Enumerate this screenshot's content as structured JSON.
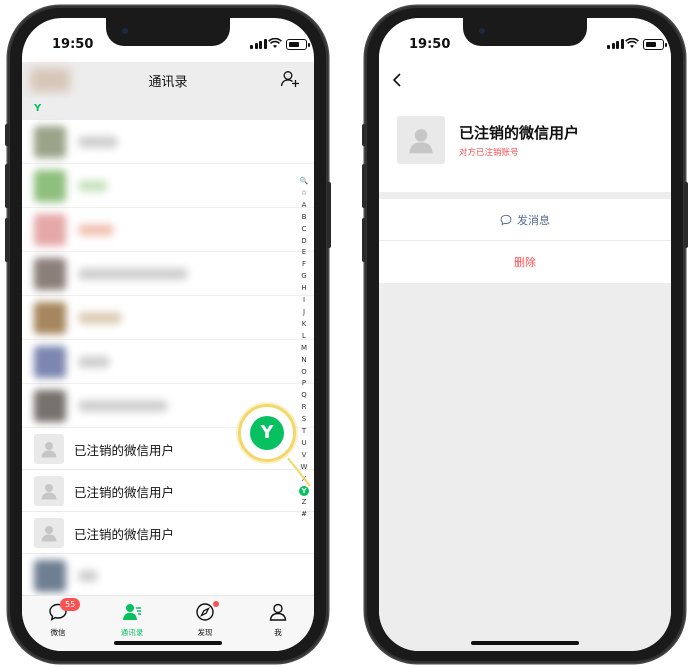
{
  "status_bar": {
    "time": "19:50"
  },
  "contacts_screen": {
    "title": "通讯录",
    "section_letter": "Y",
    "deregistered_rows": [
      {
        "name": "已注销的微信用户"
      },
      {
        "name": "已注销的微信用户"
      },
      {
        "name": "已注销的微信用户"
      }
    ],
    "index_letters": [
      "🔍",
      "☆",
      "A",
      "B",
      "C",
      "D",
      "E",
      "F",
      "G",
      "H",
      "I",
      "J",
      "K",
      "L",
      "M",
      "N",
      "O",
      "P",
      "Q",
      "R",
      "S",
      "T",
      "U",
      "V",
      "W",
      "X",
      "Y",
      "Z",
      "#"
    ],
    "active_index": "Y",
    "magnified_letter": "Y",
    "tabs": [
      {
        "label": "微信",
        "badge": "55"
      },
      {
        "label": "通讯录"
      },
      {
        "label": "发现"
      },
      {
        "label": "我"
      }
    ],
    "active_tab": "通讯录",
    "colors": {
      "accent": "#07c160",
      "badge": "#fa5151",
      "highlight_ring": "#f2d869"
    }
  },
  "profile_screen": {
    "name": "已注销的微信用户",
    "subtitle": "对方已注销账号",
    "send_message_label": "发消息",
    "delete_label": "删除",
    "colors": {
      "link": "#576b95",
      "danger": "#fa5151"
    }
  }
}
